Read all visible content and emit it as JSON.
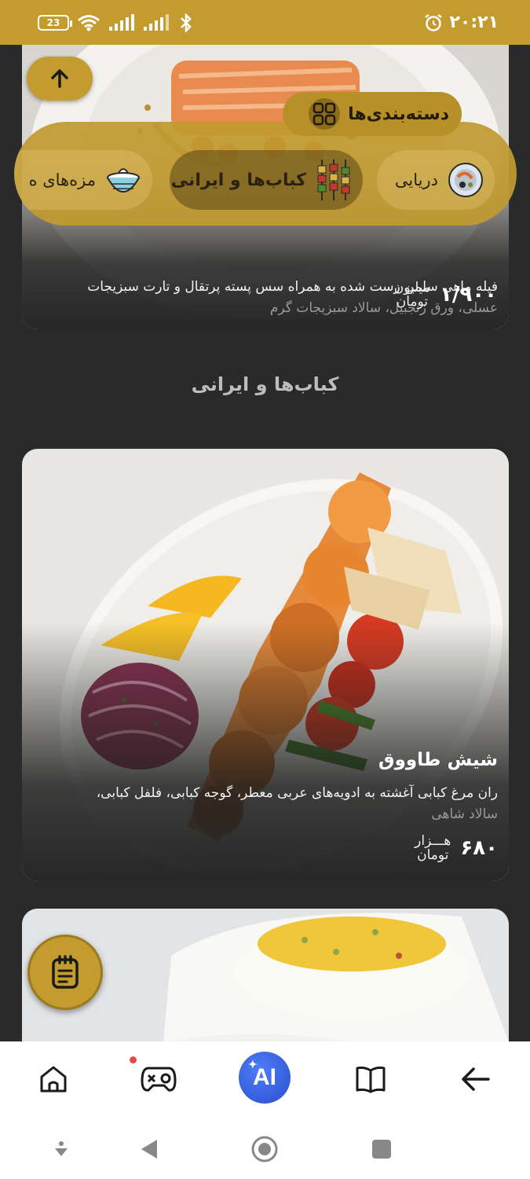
{
  "status_bar": {
    "battery": "23",
    "time": "۲۰:۲۱"
  },
  "categories_header": {
    "label": "دسته‌بندی‌ها"
  },
  "categories": [
    {
      "label": "دریایی",
      "icon": "seafood-icon"
    },
    {
      "label": "کباب‌ها و ایرانی",
      "icon": "kebab-icon",
      "active": true
    },
    {
      "label": "مزه‌های ه",
      "icon": "dip-bowl-icon"
    }
  ],
  "top_card": {
    "desc_line1": "فیله ماهی سلمن رست شده به همراه سس پسته پرتقال و تارت سبزیجات",
    "desc_line2": "عسلی، ورق زنجبیل، سالاد سبزیجات گرم",
    "price": "۱/۹۰۰",
    "price_unit_top": "میلیون",
    "price_unit_bottom": "تومان"
  },
  "section": {
    "title": "کباب‌ها و ایرانی"
  },
  "featured_card": {
    "title": "شیش طاووق",
    "desc_line1": "ران مرغ کبابی آغشته به ادویه‌های عربی معطر، گوجه کبابی، فلفل کبابی،",
    "desc_line2": "سالاد شاهی",
    "price": "۶۸۰",
    "price_unit_top": "هـــزار",
    "price_unit_bottom": "تومان"
  },
  "bottom_nav": {
    "ai_label": "AI",
    "items": [
      "home-icon",
      "game-controller-icon",
      "ai-button",
      "book-icon",
      "back-arrow-icon"
    ]
  },
  "colors": {
    "accent": "#c39b2f",
    "background": "#2a2a2a",
    "ai": "#2f55d4"
  }
}
